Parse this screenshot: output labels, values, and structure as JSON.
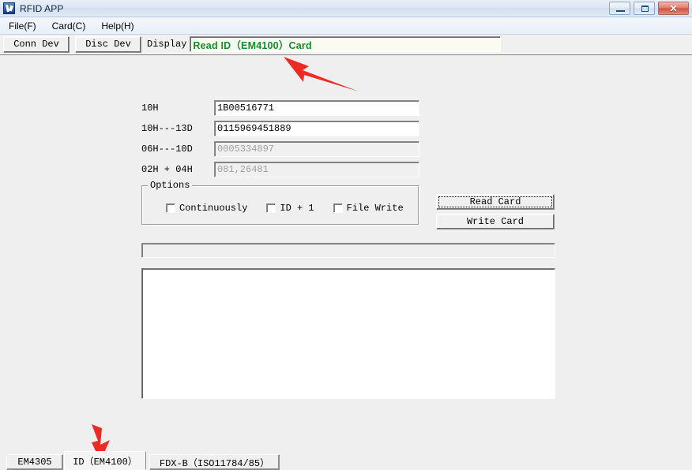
{
  "window": {
    "title": "RFID APP",
    "icon": "rfid-app-icon",
    "buttons": {
      "minimize": "minimize-icon",
      "maximize": "maximize-icon",
      "close": "✕"
    }
  },
  "menubar": {
    "items": [
      {
        "label": "File(F)",
        "name": "menu-file"
      },
      {
        "label": "Card(C)",
        "name": "menu-card"
      },
      {
        "label": "Help(H)",
        "name": "menu-help"
      }
    ]
  },
  "toolbar": {
    "conn_dev_label": "Conn Dev",
    "disc_dev_label": "Disc Dev",
    "display_label": "Display",
    "display_value": "Read ID（EM4100）Card",
    "display_color": "#0f8f2c"
  },
  "form": {
    "rows": [
      {
        "label": "10H",
        "value": "1B00516771",
        "readonly": false
      },
      {
        "label": "10H---13D",
        "value": "0115969451889",
        "readonly": false
      },
      {
        "label": "06H---10D",
        "value": "0005334897",
        "readonly": true
      },
      {
        "label": "02H + 04H",
        "value": "081,26481",
        "readonly": true
      }
    ]
  },
  "options": {
    "title": "Options",
    "checkboxes": [
      {
        "label": "Continuously",
        "checked": false,
        "name": "checkbox-continuously"
      },
      {
        "label": "ID + 1",
        "checked": false,
        "name": "checkbox-id-plus-1"
      },
      {
        "label": "File Write",
        "checked": false,
        "name": "checkbox-file-write"
      }
    ]
  },
  "actions": {
    "read_card_label": "Read Card",
    "write_card_label": "Write Card"
  },
  "progress": {
    "value": 0
  },
  "log": {
    "text": ""
  },
  "tabs": {
    "items": [
      {
        "label": "EM4305",
        "active": false,
        "name": "tab-em4305"
      },
      {
        "label": "ID（EM4100）",
        "active": true,
        "name": "tab-id-em4100"
      },
      {
        "label": "FDX-B（ISO11784/85）",
        "active": false,
        "name": "tab-fdxb"
      }
    ]
  },
  "annotations": {
    "arrow_color": "#ee2b22",
    "arrow_top": "arrow-pointing-to-display-field",
    "arrow_bottom": "arrow-pointing-to-id-em4100-tab"
  }
}
